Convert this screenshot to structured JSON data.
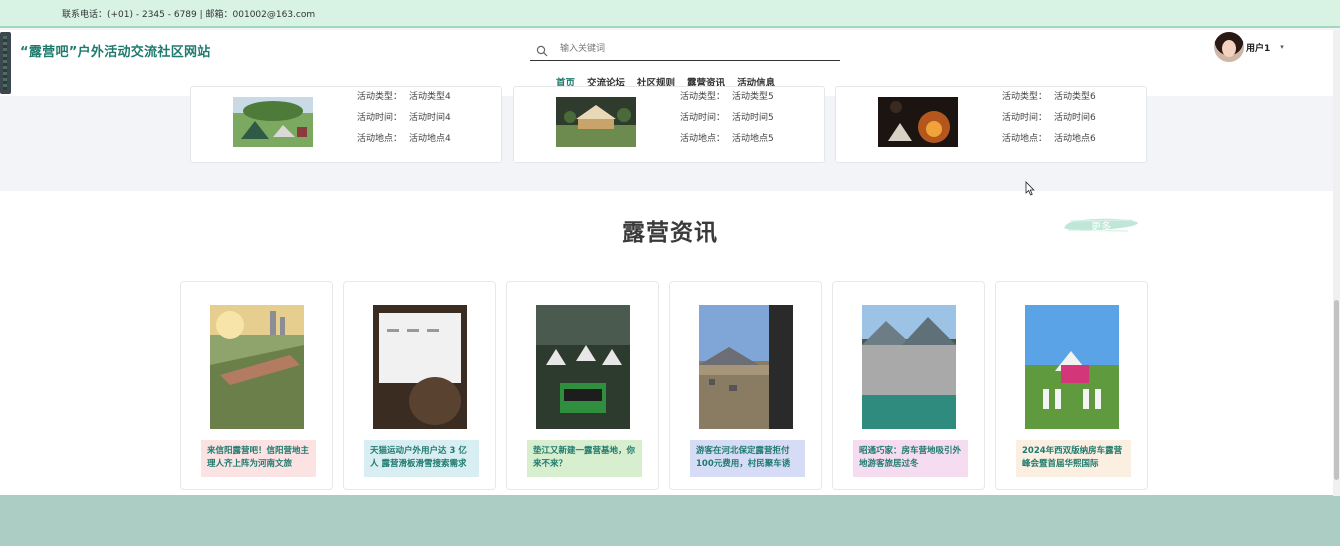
{
  "topbar": {
    "contact": "联系电话：(+01) - 2345 - 6789 | 邮箱：001002@163.com"
  },
  "header": {
    "title": "“露营吧”户外活动交流社区网站",
    "search_placeholder": "输入关键词",
    "nav": [
      {
        "label": "首页",
        "active": true
      },
      {
        "label": "交流论坛",
        "active": false
      },
      {
        "label": "社区规则",
        "active": false
      },
      {
        "label": "露营资讯",
        "active": false
      },
      {
        "label": "活动信息",
        "active": false
      }
    ],
    "user": {
      "name": "用户1",
      "caret": "▾"
    }
  },
  "activities": [
    {
      "type_key": "活动类型：",
      "type_val": "活动类型4",
      "time_key": "活动时间：",
      "time_val": "活动时间4",
      "place_key": "活动地点：",
      "place_val": "活动地点4"
    },
    {
      "type_key": "活动类型：",
      "type_val": "活动类型5",
      "time_key": "活动时间：",
      "time_val": "活动时间5",
      "place_key": "活动地点：",
      "place_val": "活动地点5"
    },
    {
      "type_key": "活动类型：",
      "type_val": "活动类型6",
      "time_key": "活动时间：",
      "time_val": "活动时间6",
      "place_key": "活动地点：",
      "place_val": "活动地点6"
    }
  ],
  "news": {
    "title": "露营资讯",
    "more_label": "更多",
    "items": [
      {
        "caption": "来信阳露营吧！信阳营地主理人齐上阵为河南文旅",
        "bg": "#fbe3e4"
      },
      {
        "caption": "天猫运动户外用户达 3 亿人 露营滑板滑雪搜索需求",
        "bg": "#d9eef2"
      },
      {
        "caption": "垫江又新建一露营基地，你来不来？",
        "bg": "#d8efcf"
      },
      {
        "caption": "游客在河北保定露营拒付100元费用，村民聚车诱",
        "bg": "#d6dcf6"
      },
      {
        "caption": "昭通巧家：房车营地吸引外地游客旅居过冬",
        "bg": "#f6dcf1"
      },
      {
        "caption": "2024年西双版纳房车露营峰会暨首届华熙国际",
        "bg": "#fbefe2"
      }
    ]
  },
  "colors": {
    "accent": "#1f7a6e",
    "topbar": "#d8f3e4",
    "footer": "#abcdc3"
  }
}
